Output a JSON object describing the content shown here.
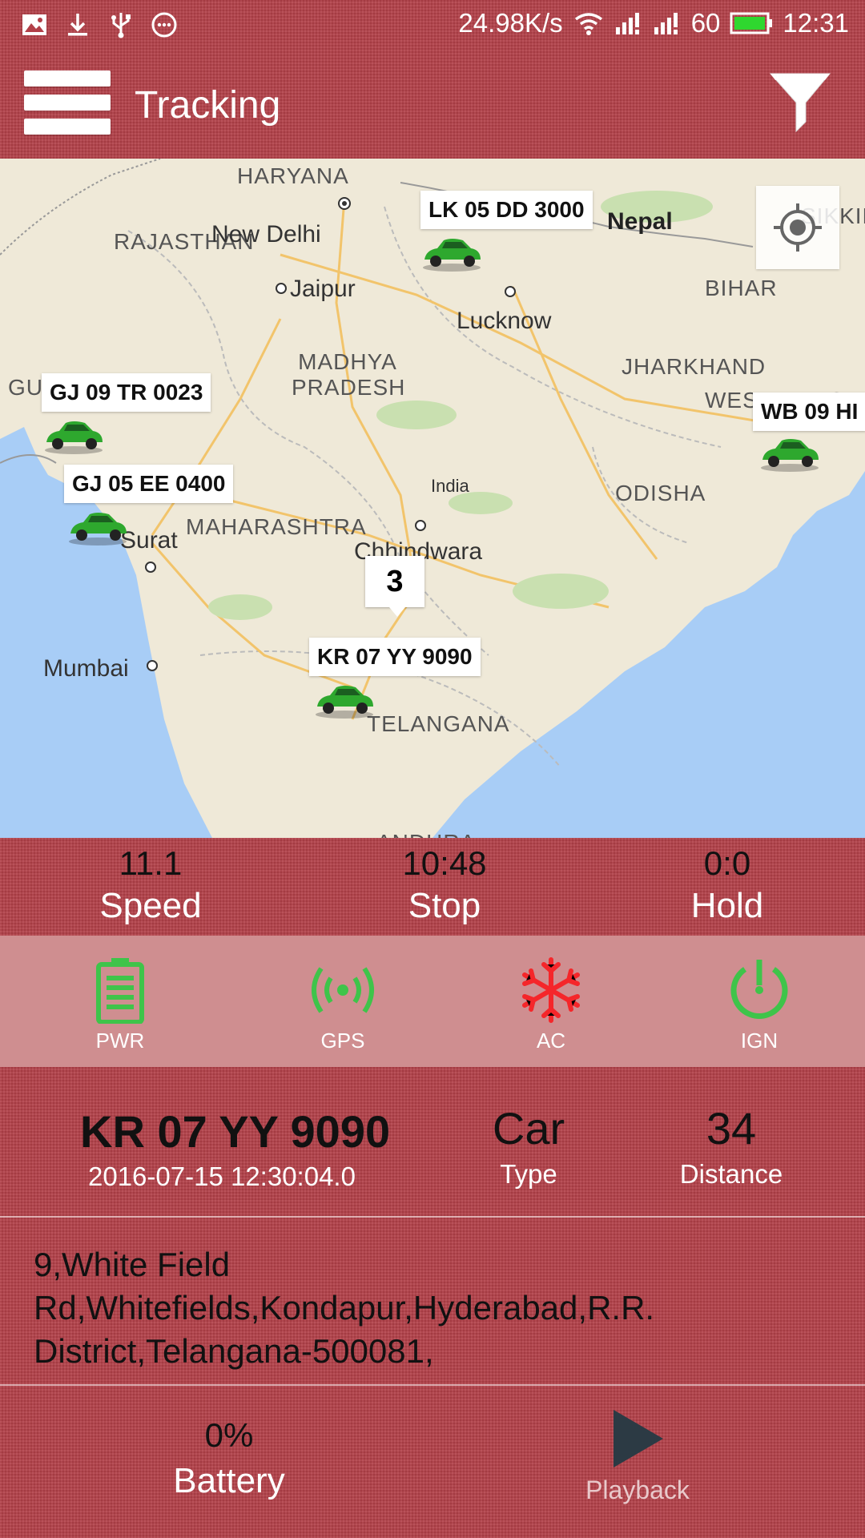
{
  "status_bar": {
    "left_icons": [
      "image-icon",
      "download-icon",
      "usb-icon",
      "more-icon"
    ],
    "speed": "24.98K/s",
    "battery_level": "60",
    "time": "12:31"
  },
  "app_bar": {
    "title": "Tracking"
  },
  "map": {
    "region_labels": [
      "HARYANA",
      "RAJASTHAN",
      "MADHYA PRADESH",
      "BIHAR",
      "JHARKHAND",
      "WEST BENGAL",
      "ODISHA",
      "MAHARASHTRA",
      "TELANGANA",
      "GUJARAT",
      "SIKKIM",
      "ANDHRA"
    ],
    "city_labels": [
      "New Delhi",
      "Jaipur",
      "Lucknow",
      "Surat",
      "Mumbai",
      "Chhindwara",
      "India"
    ],
    "country_label": "Nepal",
    "vehicles": [
      {
        "plate": "LK 05 DD 3000"
      },
      {
        "plate": "GJ 09 TR 0023"
      },
      {
        "plate": "GJ 05 EE 0400"
      },
      {
        "plate": "KR 07 YY 9090"
      },
      {
        "plate": "WB 09 HI"
      }
    ],
    "cluster_count": "3"
  },
  "stats": {
    "speed": {
      "value": "11.1",
      "label": "Speed"
    },
    "stop": {
      "value": "10:48",
      "label": "Stop"
    },
    "hold": {
      "value": "0:0",
      "label": "Hold"
    }
  },
  "sensors": {
    "pwr": {
      "label": "PWR",
      "color": "#3fc44a"
    },
    "gps": {
      "label": "GPS",
      "color": "#3fc44a"
    },
    "ac": {
      "label": "AC",
      "color": "#f5262a"
    },
    "ign": {
      "label": "IGN",
      "color": "#3fc44a"
    }
  },
  "vehicle": {
    "plate": "KR 07 YY 9090",
    "timestamp": "2016-07-15 12:30:04.0",
    "type": {
      "value": "Car",
      "label": "Type"
    },
    "distance": {
      "value": "34",
      "label": "Distance"
    }
  },
  "address": "9,White Field Rd,Whitefields,Kondapur,Hyderabad,R.R. District,Telangana-500081,",
  "footer": {
    "battery": {
      "value": "0%",
      "label": "Battery"
    },
    "playback_label": "Playback"
  },
  "colors": {
    "bar_red": "#b23f48",
    "sensor_band": "#cf8e90",
    "sea": "#a8cdf6",
    "land": "#efe9d8",
    "car_green": "#2ea82e"
  }
}
